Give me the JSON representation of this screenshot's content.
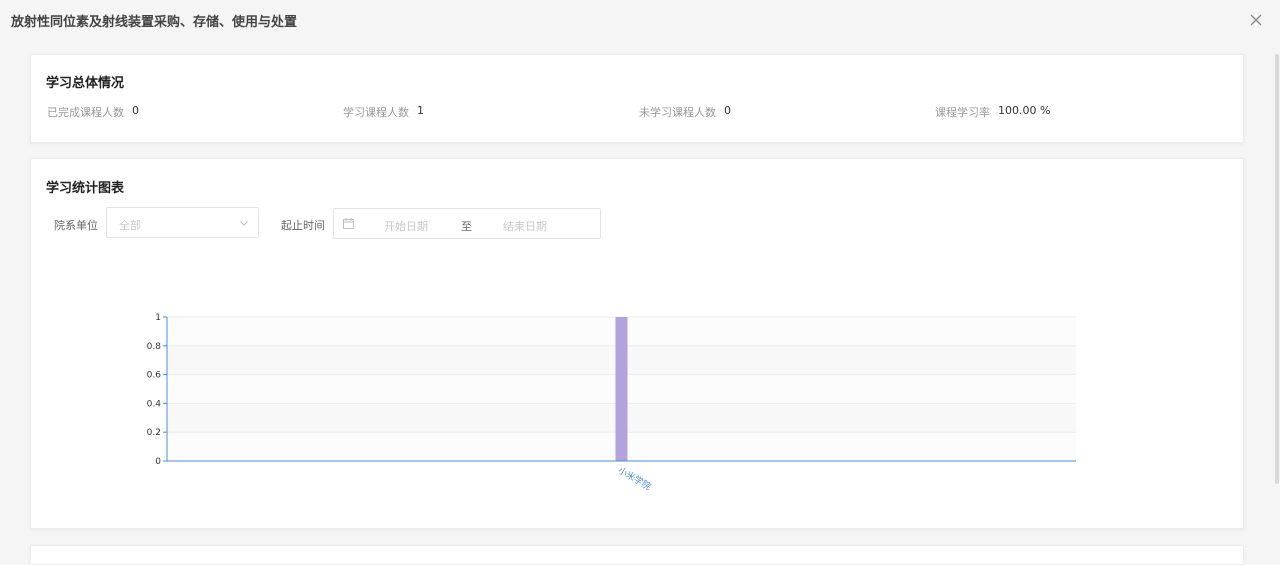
{
  "dialog": {
    "title": "放射性同位素及射线装置采购、存储、使用与处置",
    "close_icon": "close-icon"
  },
  "overview": {
    "title": "学习总体情况",
    "stats": [
      {
        "label": "已完成课程人数",
        "value": "0"
      },
      {
        "label": "学习课程人数",
        "value": "1"
      },
      {
        "label": "未学习课程人数",
        "value": "0"
      },
      {
        "label": "课程学习率",
        "value": "100.00 %"
      }
    ]
  },
  "stats_chart_section": {
    "title": "学习统计图表",
    "department_filter": {
      "label": "院系单位",
      "placeholder": "全部",
      "icon": "chevron-down-icon"
    },
    "date_filter": {
      "label": "起止时间",
      "start_placeholder": "开始日期",
      "separator": "至",
      "end_placeholder": "结束日期",
      "icon": "calendar-icon"
    }
  },
  "colors": {
    "bar": "#b4a2dc",
    "axis": "#4a8fd6",
    "band": "#f8f8f8",
    "grid": "#ececec"
  },
  "chart_data": {
    "type": "bar",
    "categories": [
      "小米学院"
    ],
    "values": [
      1
    ],
    "ylim": [
      0,
      1
    ],
    "yticks": [
      "0",
      "0.2",
      "0.4",
      "0.6",
      "0.8",
      "1"
    ],
    "grid": true,
    "xlabel": "",
    "ylabel": "",
    "title": ""
  }
}
